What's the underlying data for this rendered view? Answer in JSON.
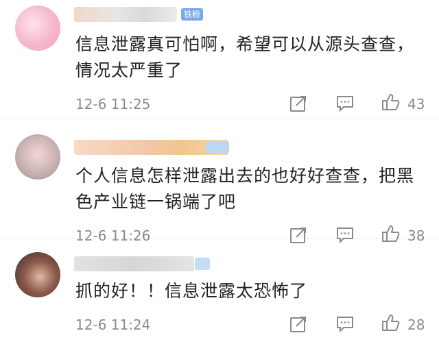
{
  "comments": [
    {
      "badge": "铁粉",
      "text": "信息泄露真可怕啊，希望可以从源头查查，情况太严重了",
      "time": "12-6 11:25",
      "likes": "43"
    },
    {
      "text": "个人信息怎样泄露出去的也好好查查，把黑色产业链一锅端了吧",
      "time": "12-6 11:26",
      "likes": "38"
    },
    {
      "text": "抓的好！！信息泄露太恐怖了",
      "time": "12-6 11:24",
      "likes": "28"
    }
  ],
  "icons": {
    "share": "share-icon",
    "reply": "comment-icon",
    "like": "like-icon"
  },
  "colors": {
    "text": "#222222",
    "meta": "#8a8a8a",
    "icon": "#8a8a8a",
    "badge": "#7aa7ee"
  }
}
